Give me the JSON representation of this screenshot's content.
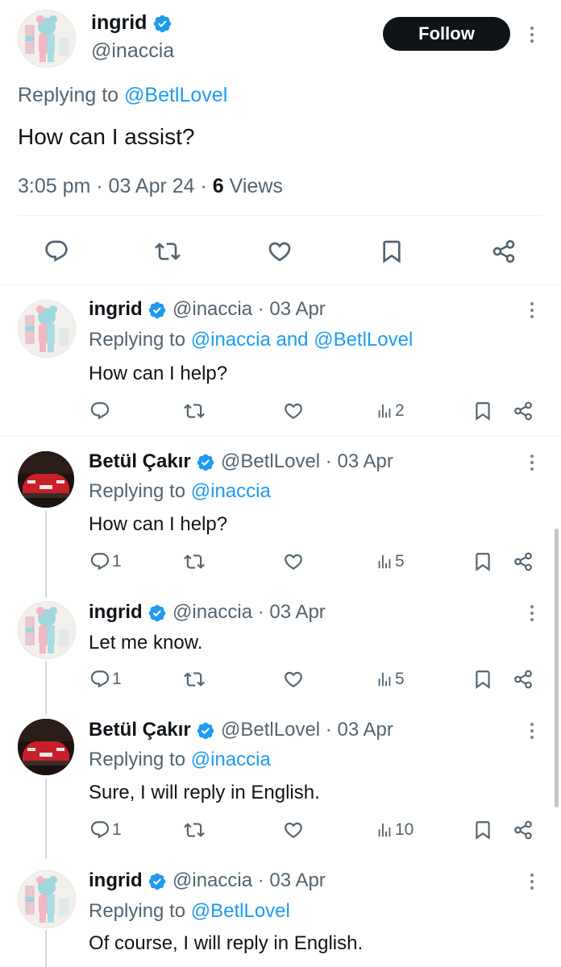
{
  "main_tweet": {
    "name": "ingrid",
    "handle": "@inaccia",
    "follow_label": "Follow",
    "replying_prefix": "Replying to",
    "replying_to": "@BetlLovel",
    "text": "How can I assist?",
    "time": "3:05 pm · 03 Apr 24 · ",
    "views_count": "6",
    "views_label": " Views"
  },
  "replies": [
    {
      "name": "ingrid",
      "meta": "@inaccia · 03 Apr",
      "replying_prefix": "Replying to",
      "replying_to": "@inaccia and @BetlLovel",
      "text": "How can I help?",
      "reply_count": "",
      "views": "2"
    },
    {
      "name": "Betül Çakır",
      "meta": "@BetlLovel · 03 Apr",
      "replying_prefix": "Replying to",
      "replying_to": "@inaccia",
      "text": "How can I help?",
      "reply_count": "1",
      "views": "5"
    },
    {
      "name": "ingrid",
      "meta": "@inaccia · 03 Apr",
      "text": "Let me know.",
      "reply_count": "1",
      "views": "5"
    },
    {
      "name": "Betül Çakır",
      "meta": "@BetlLovel · 03 Apr",
      "replying_prefix": "Replying to",
      "replying_to": "@inaccia",
      "text": "Sure, I will reply in English.",
      "reply_count": "1",
      "views": "10"
    },
    {
      "name": "ingrid",
      "meta": "@inaccia · 03 Apr",
      "replying_prefix": "Replying to",
      "replying_to": "@BetlLovel",
      "text": "Of course, I will reply in English."
    }
  ],
  "colors": {
    "link": "#1d9bf0",
    "verified": "#1d9bf0",
    "text": "#0f1419",
    "secondary": "#536471"
  }
}
